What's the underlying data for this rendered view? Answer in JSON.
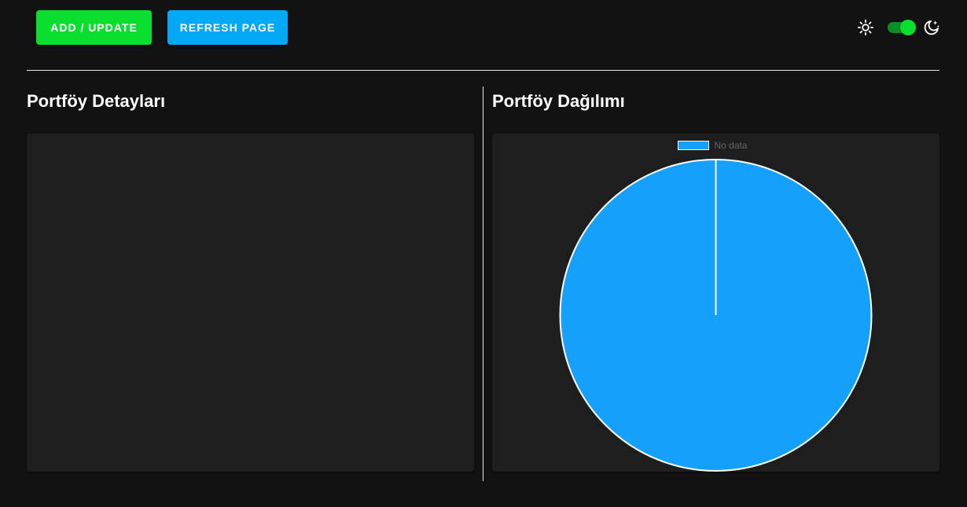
{
  "toolbar": {
    "add_update_label": "ADD / UPDATE",
    "refresh_label": "REFRESH PAGE",
    "add_color": "#0ade2e",
    "refresh_color": "#03a9f4"
  },
  "theme": {
    "light_icon": "sun-icon",
    "dark_icon": "moon-icon",
    "dark_mode_enabled": true
  },
  "sections": {
    "details_title": "Portföy Detayları",
    "distribution_title": "Portföy Dağılımı"
  },
  "chart_data": {
    "type": "pie",
    "categories": [
      "No data"
    ],
    "values": [
      1
    ],
    "colors": [
      "#15a0fc"
    ],
    "legend": "top"
  }
}
